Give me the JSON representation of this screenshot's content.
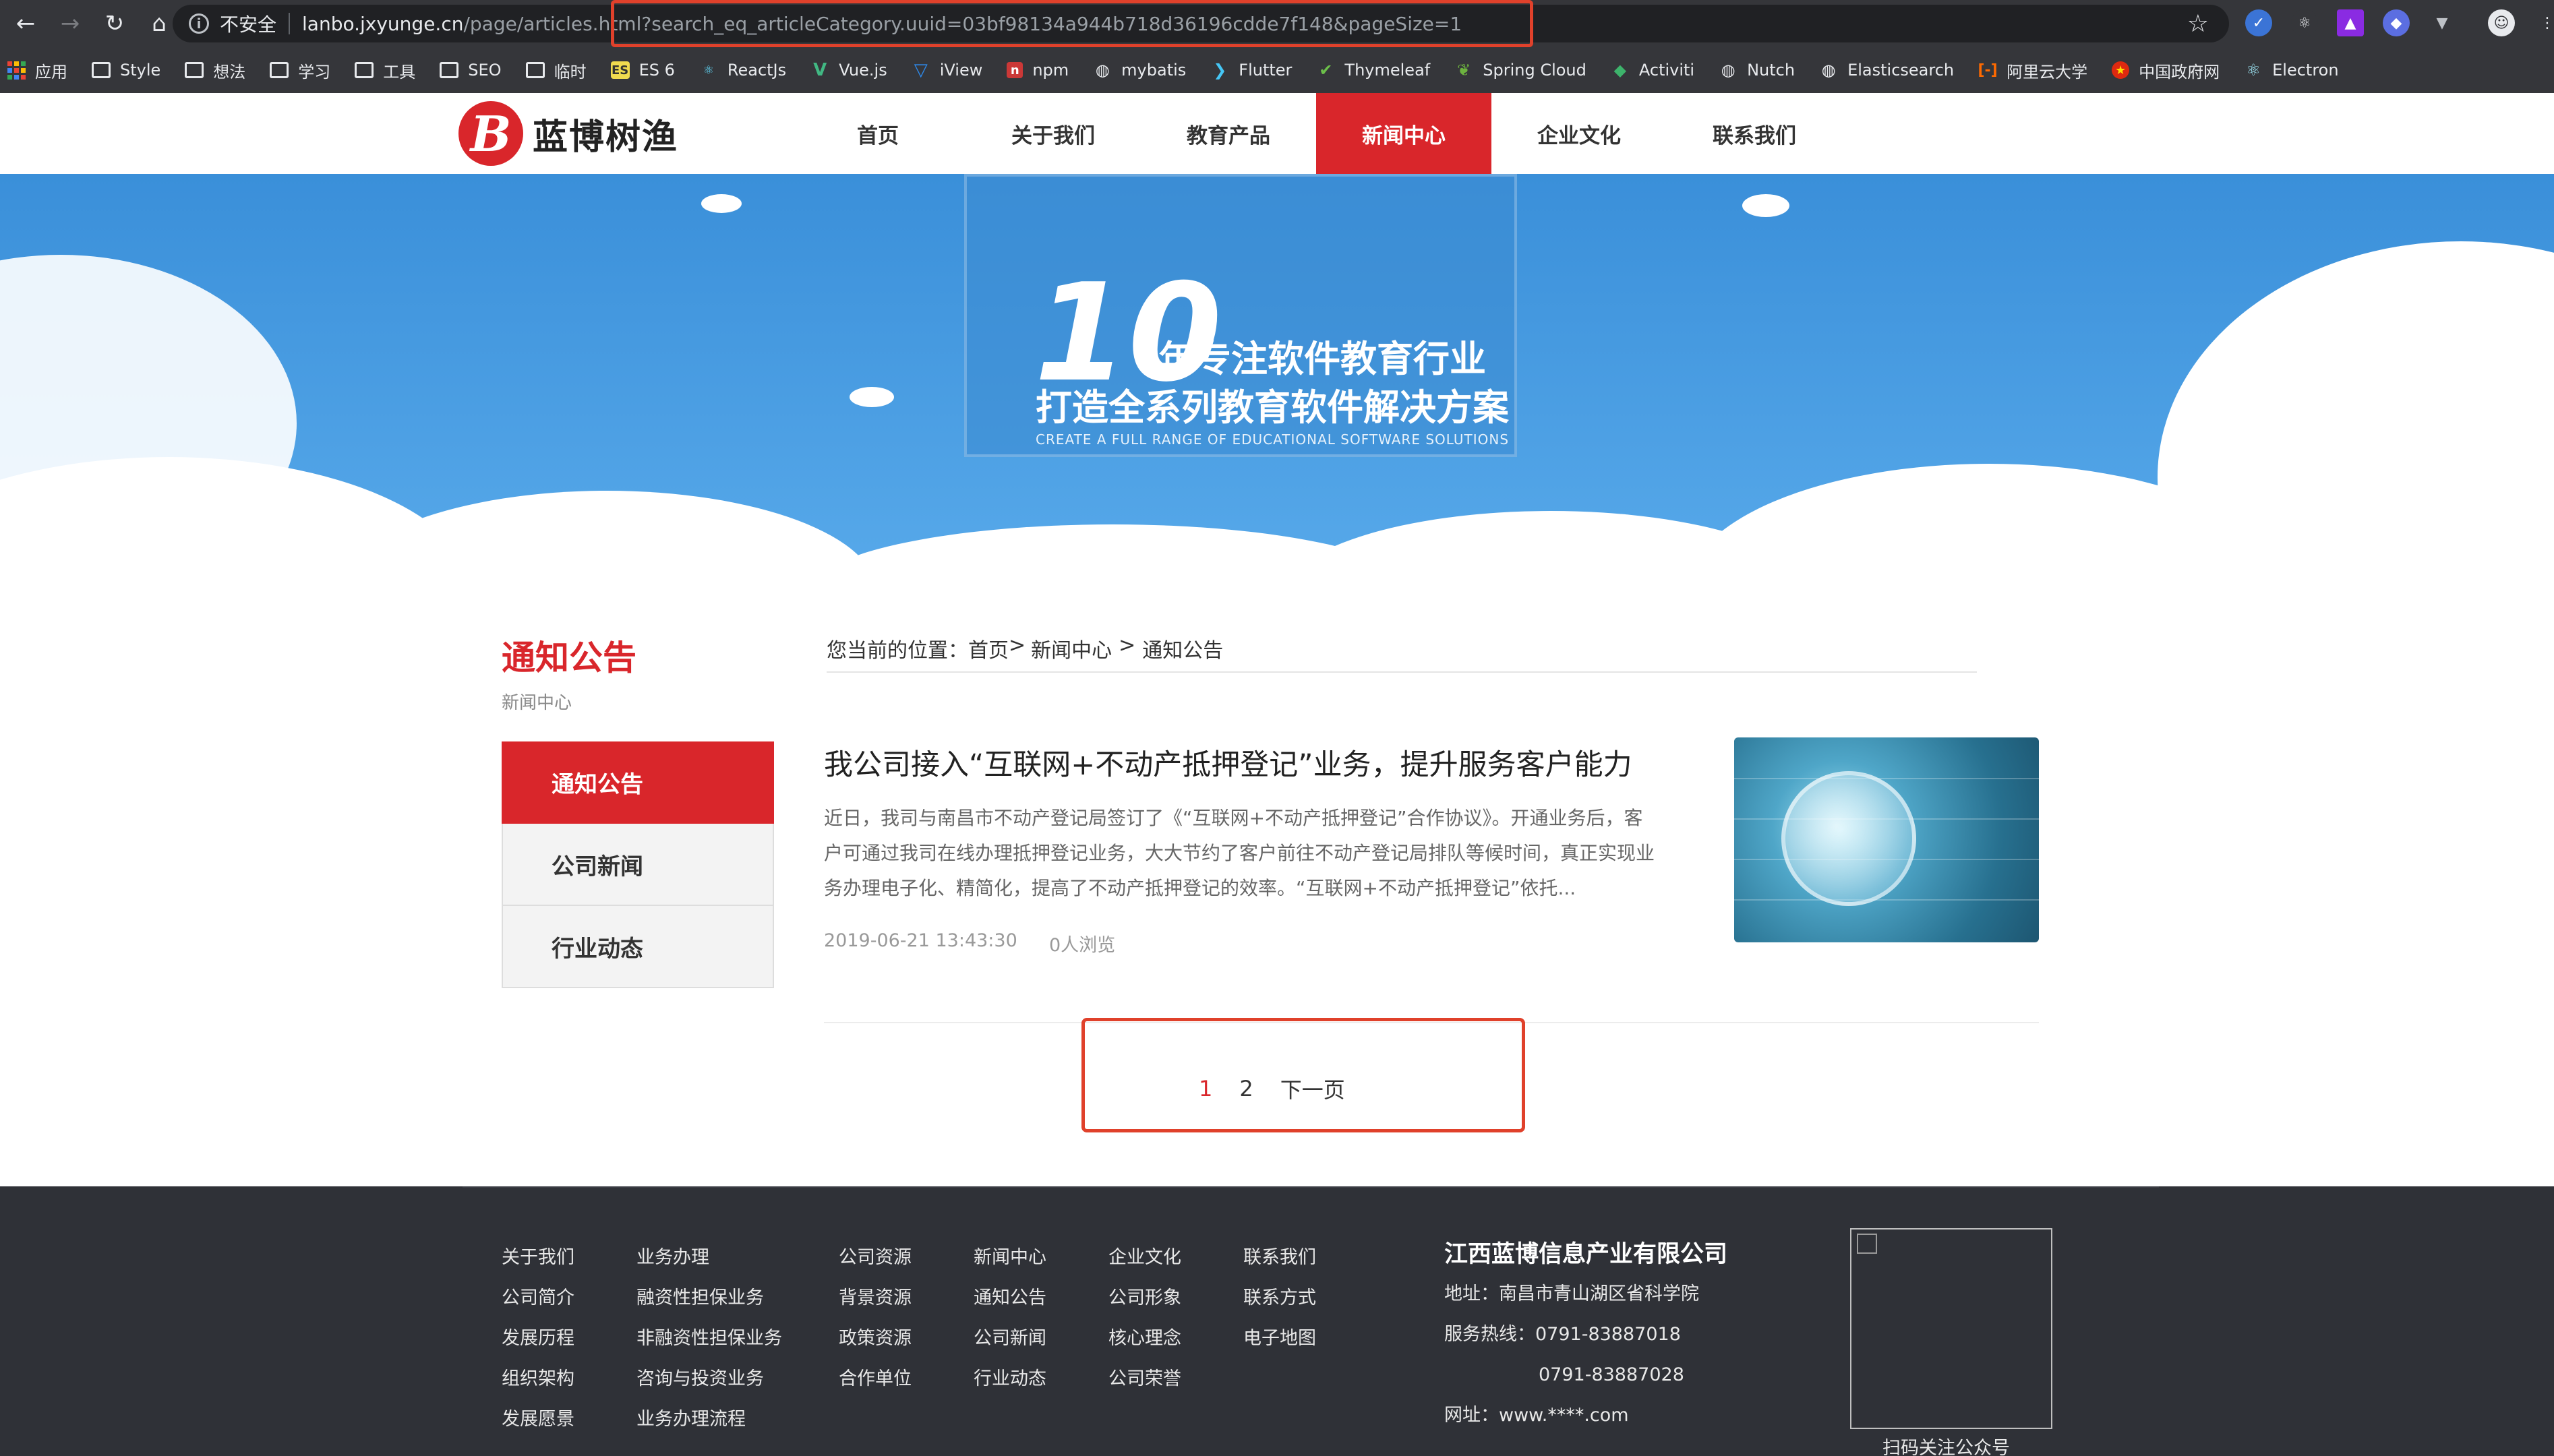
{
  "browser": {
    "insecure_label": "不安全",
    "url_host": "lanbo.jxyunge.cn",
    "url_path": "/page/articles.html?search_eq_articleCategory.uuid=03bf98134a944b718d36196cdde7f148&pageSize=1",
    "bookmarks": [
      {
        "label": "应用",
        "icon": "apps-icon"
      },
      {
        "label": "Style",
        "icon": "folder-icon"
      },
      {
        "label": "想法",
        "icon": "folder-icon"
      },
      {
        "label": "学习",
        "icon": "folder-icon"
      },
      {
        "label": "工具",
        "icon": "folder-icon"
      },
      {
        "label": "SEO",
        "icon": "folder-icon"
      },
      {
        "label": "临时",
        "icon": "folder-icon"
      },
      {
        "label": "ES 6",
        "icon": "es-icon"
      },
      {
        "label": "ReactJs",
        "icon": "react-icon"
      },
      {
        "label": "Vue.js",
        "icon": "vue-icon"
      },
      {
        "label": "iView",
        "icon": "iview-icon"
      },
      {
        "label": "npm",
        "icon": "npm-icon"
      },
      {
        "label": "mybatis",
        "icon": "globe-icon"
      },
      {
        "label": "Flutter",
        "icon": "flutter-icon"
      },
      {
        "label": "Thymeleaf",
        "icon": "thymeleaf-icon"
      },
      {
        "label": "Spring Cloud",
        "icon": "spring-icon"
      },
      {
        "label": "Activiti",
        "icon": "activiti-icon"
      },
      {
        "label": "Nutch",
        "icon": "globe-icon"
      },
      {
        "label": "Elasticsearch",
        "icon": "globe-icon"
      },
      {
        "label": "阿里云大学",
        "icon": "aliyun-icon"
      },
      {
        "label": "中国政府网",
        "icon": "gov-icon"
      },
      {
        "label": "Electron",
        "icon": "electron-icon"
      }
    ]
  },
  "site": {
    "logo_text": "蓝博树渔",
    "logo_letter": "B",
    "nav": [
      "首页",
      "关于我们",
      "教育产品",
      "新闻中心",
      "企业文化",
      "联系我们"
    ],
    "active_nav": "新闻中心"
  },
  "banner": {
    "number": "10",
    "line1": "年专注软件教育行业",
    "line2": "打造全系列教育软件解决方案",
    "line_en": "CREATE A FULL RANGE OF EDUCATIONAL SOFTWARE SOLUTIONS"
  },
  "sidebar": {
    "title": "通知公告",
    "subtitle": "新闻中心",
    "items": [
      "通知公告",
      "公司新闻",
      "行业动态"
    ]
  },
  "breadcrumb": {
    "prefix": "您当前的位置：",
    "home": "首页",
    "sep1": ">",
    "section": "新闻中心",
    "sep2": ">",
    "current": "通知公告"
  },
  "article": {
    "title": "我公司接入“互联网+不动产抵押登记”业务，提升服务客户能力",
    "summary": "近日，我司与南昌市不动产登记局签订了《“互联网+不动产抵押登记”合作协议》。开通业务后，客户可通过我司在线办理抵押登记业务，大大节约了客户前往不动产登记局排队等候时间，真正实现业务办理电子化、精简化，提高了不动产抵押登记的效率。“互联网+不动产抵押登记”依托...",
    "date": "2019-06-21 13:43:30",
    "views": "0人浏览"
  },
  "pagination": {
    "pages": [
      "1",
      "2"
    ],
    "current": "1",
    "next_label": "下一页"
  },
  "footer": {
    "columns": [
      [
        "关于我们",
        "公司简介",
        "发展历程",
        "组织架构",
        "发展愿景"
      ],
      [
        "业务办理",
        "融资性担保业务",
        "非融资性担保业务",
        "咨询与投资业务",
        "业务办理流程"
      ],
      [
        "公司资源",
        "背景资源",
        "政策资源",
        "合作单位"
      ],
      [
        "新闻中心",
        "通知公告",
        "公司新闻",
        "行业动态"
      ],
      [
        "企业文化",
        "公司形象",
        "核心理念",
        "公司荣誉"
      ],
      [
        "联系我们",
        "联系方式",
        "电子地图"
      ]
    ],
    "company_name": "江西蓝博信息产业有限公司",
    "address": "地址：南昌市青山湖区省科学院",
    "hotline": "服务热线：0791-83887018",
    "hotline2": "0791-83887028",
    "website": "网址：www.****.com",
    "qr_caption": "扫码关注公众号"
  },
  "colors": {
    "brand_red": "#d9262b",
    "footer_bg": "#2f3137",
    "highlight_box": "#e0412b"
  }
}
